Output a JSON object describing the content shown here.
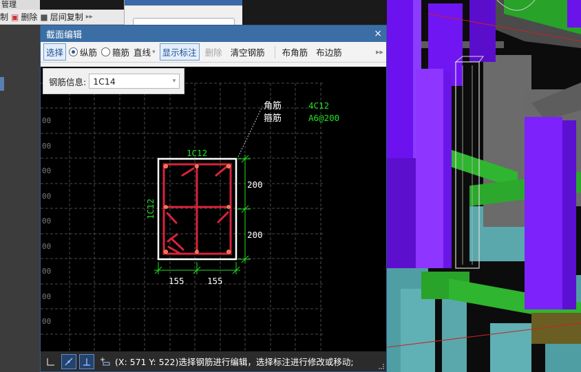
{
  "background_app": {
    "top_label": "管理",
    "toolbar": {
      "left_text": "制",
      "delete_label": "删除",
      "floor_copy_label": "层间复制"
    }
  },
  "dialog": {
    "title": "截面编辑",
    "close_glyph": "×",
    "toolbar": {
      "select_label": "选择",
      "longitudinal_label": "纵筋",
      "stirrup_label": "箍筋",
      "line_type_value": "直线",
      "show_dims_label": "显示标注",
      "delete_label": "删除",
      "clear_rebar_label": "清空钢筋",
      "corner_rebar_label": "布角筋",
      "edge_rebar_label": "布边筋",
      "more_glyph": "▸▸"
    },
    "rebar_info": {
      "label": "钢筋信息:",
      "value": "1C14"
    },
    "drawing": {
      "leader_label_corner": "角筋",
      "leader_label_stirrup": "箍筋",
      "corner_spec": "4C12",
      "stirrup_spec": "A6@200",
      "top_edge_spec": "1C12",
      "left_edge_spec": "1C12",
      "dim_right_upper": "200",
      "dim_right_lower": "200",
      "dim_bottom_left": "155",
      "dim_bottom_right": "155",
      "axis_tick_label": "00"
    },
    "status": {
      "text": "(X: 571 Y: 522)选择钢筋进行编辑，选择标注进行修改或移动;",
      "icons": [
        "ortho-icon",
        "snap-icon",
        "perpendicular-icon",
        "dynamic-input-icon"
      ]
    }
  },
  "colors": {
    "title_bar": "#3a6ea5",
    "rebar": "#d9233a",
    "dimension": "#22e022",
    "section_outline": "#ffffff",
    "grid": "#555555"
  }
}
